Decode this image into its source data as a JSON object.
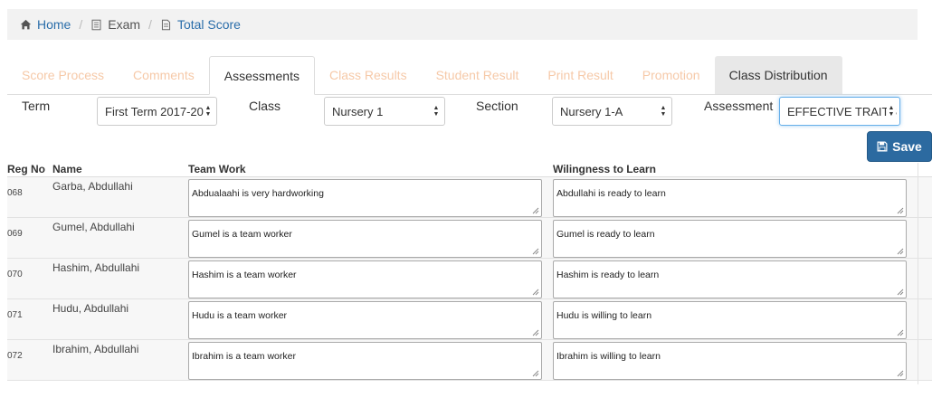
{
  "breadcrumb": {
    "home": "Home",
    "exam": "Exam",
    "total_score": "Total Score"
  },
  "tabs": [
    {
      "label": "Score Process"
    },
    {
      "label": "Comments"
    },
    {
      "label": "Assessments"
    },
    {
      "label": "Class Results"
    },
    {
      "label": "Student Result"
    },
    {
      "label": "Print Result"
    },
    {
      "label": "Promotion"
    },
    {
      "label": "Class Distribution"
    }
  ],
  "filters": {
    "term_label": "Term",
    "term_value": "First Term 2017-20",
    "class_label": "Class",
    "class_value": "Nursery 1",
    "section_label": "Section",
    "section_value": "Nursery 1-A",
    "assessment_label": "Assessment",
    "assessment_value": "EFFECTIVE TRAITS"
  },
  "save_label": "Save",
  "table": {
    "headers": {
      "reg_no": "Reg No",
      "name": "Name",
      "team_work": "Team Work",
      "willingness": "Wilingness to Learn"
    },
    "rows": [
      {
        "reg": "068",
        "name": "Garba, Abdullahi",
        "team_work": "Abdualaahi is very hardworking",
        "willingness": "Abdullahi is ready to learn"
      },
      {
        "reg": "069",
        "name": "Gumel, Abdullahi",
        "team_work": "Gumel is a team worker",
        "willingness": "Gumel is ready to learn"
      },
      {
        "reg": "070",
        "name": "Hashim, Abdullahi",
        "team_work": "Hashim is a team worker",
        "willingness": "Hashim is ready to learn"
      },
      {
        "reg": "071",
        "name": "Hudu, Abdullahi",
        "team_work": "Hudu is a team worker",
        "willingness": "Hudu is willing to learn"
      },
      {
        "reg": "072",
        "name": "Ibrahim, Abdullahi",
        "team_work": "Ibrahim is a team worker",
        "willingness": "Ibrahim is willing to learn"
      }
    ]
  },
  "icons": {
    "home": "home-icon",
    "exam": "document-icon",
    "total_score": "document-icon",
    "save": "floppy-disk-icon"
  },
  "colors": {
    "link": "#2b6eaa",
    "inactive_tab": "#f6c9a8",
    "save_button": "#2c6aa0"
  }
}
